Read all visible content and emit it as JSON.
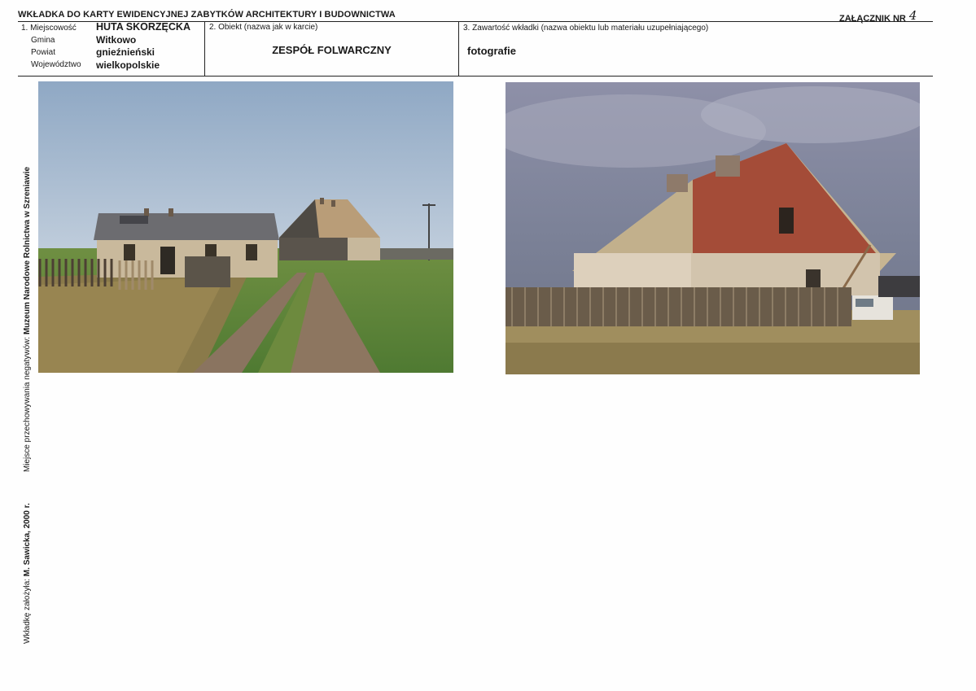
{
  "header": {
    "title": "WKŁADKA DO KARTY EWIDENCYJNEJ ZABYTKÓW ARCHITEKTURY I BUDOWNICTWA",
    "annex_label": "ZAŁĄCZNIK NR",
    "annex_number": "4"
  },
  "location": {
    "labels": [
      "1. Miejscowość",
      "Gmina",
      "Powiat",
      "Województwo"
    ],
    "values": [
      "HUTA SKORZĘCKA",
      "Witkowo",
      "gnieźnieński",
      "wielkopolskie"
    ]
  },
  "object": {
    "label": "2. Obiekt (nazwa jak w karcie)",
    "value": "ZESPÓŁ FOLWARCZNY"
  },
  "contents": {
    "label": "3. Zawartość wkładki (nazwa obiektu lub materiału uzupełniającego)",
    "value": "fotografie"
  },
  "sidebar": {
    "negatives_label": "Miejsce przechowywania negatywów:",
    "negatives_value": "Muzeum Narodowe Rolnictwa w Szreniawie",
    "author_label": "Wkładkę założyła:",
    "author_value": "M. Sawicka, 2000 r."
  },
  "colors": {
    "ink": "#1a1a1a",
    "sky": "#9fb3cc",
    "brick": "#a24a36",
    "grass": "#5f8a3a"
  }
}
